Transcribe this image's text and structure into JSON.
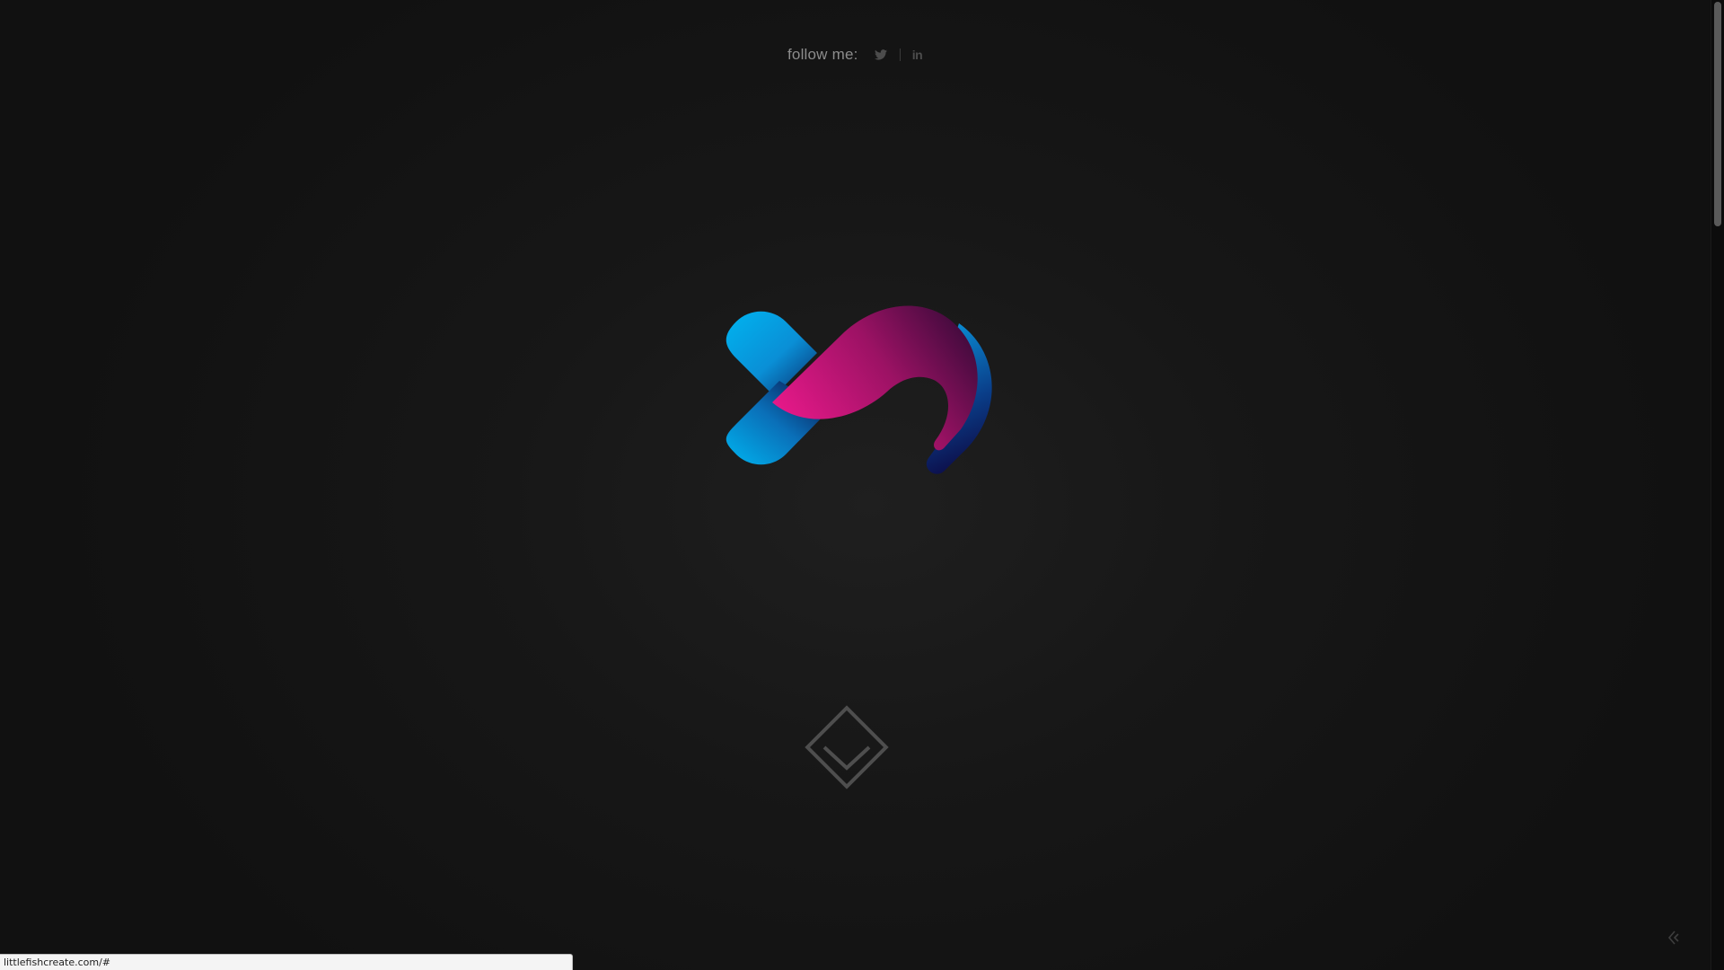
{
  "header": {
    "follow_label": "follow me:",
    "social": [
      {
        "name": "twitter",
        "icon": "twitter-bird-icon"
      },
      {
        "name": "linkedin",
        "icon": "linkedin-icon",
        "glyph": "in"
      }
    ]
  },
  "hero": {
    "logo_icon": "littlefish-logo",
    "scroll_icon": "chevron-down-diamond-icon"
  },
  "corner": {
    "icon": "arrow-left-icon"
  },
  "status_bar": {
    "url": "littlefishcreate.com/#"
  },
  "colors": {
    "background": "#151515",
    "text_muted": "#8c8c8c",
    "icon_muted": "#4c4c4c",
    "logo_cyan": "#00aeef",
    "logo_magenta": "#e0197d",
    "logo_navy": "#0d0a45"
  }
}
